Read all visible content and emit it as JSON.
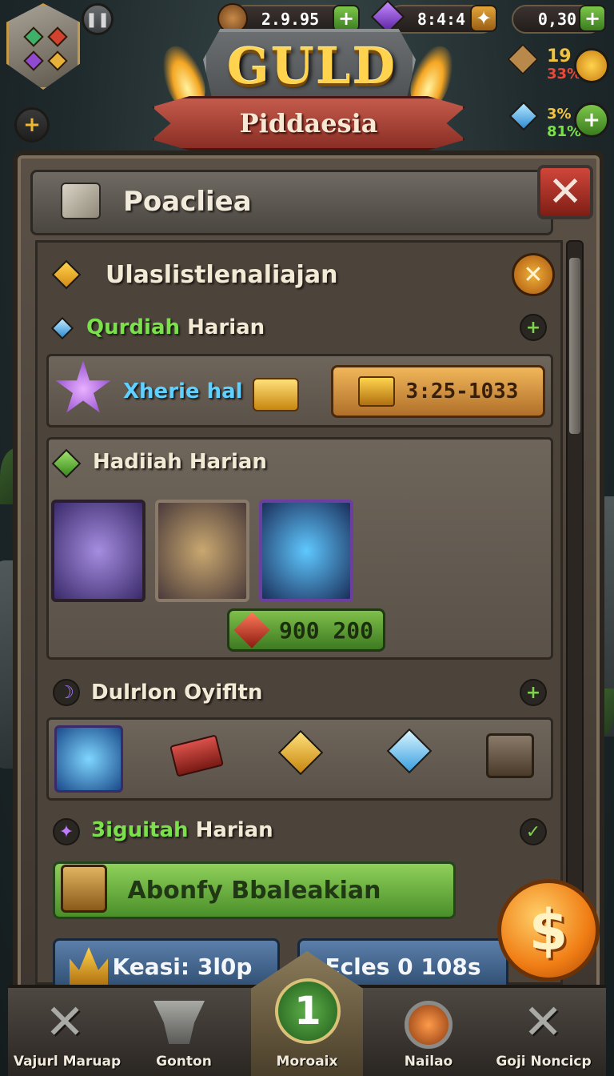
{
  "hud": {
    "resource_1": "2.9.95",
    "resource_2": "8:4:4",
    "resource_3": "0,30",
    "side_top_value": "19",
    "side_top_percent": "33%",
    "side_bottom_value": "3%",
    "side_bottom_percent": "81%"
  },
  "crest": {
    "title": "GULD",
    "subtitle": "Piddaesia"
  },
  "panel": {
    "title": "Poacliea"
  },
  "section_top": {
    "title": "Ulaslistlenaliajan"
  },
  "quest": {
    "title_highlight": "Qurdiah",
    "title_rest": " Harian",
    "item_label": "Xherie hal",
    "button_label": "3:25-1033"
  },
  "daily_reward": {
    "title": "Hadiiah Harian",
    "cost_label": "900 200"
  },
  "items_section": {
    "title": "Dulrlon Oyifltn"
  },
  "reward_section": {
    "title_highlight": "3iguitah",
    "title_rest": " Harian",
    "button_label": "Abonfy Bbaleakian"
  },
  "bottom_buttons": {
    "left": "Keasi: 3l0p",
    "right": "Ecles 0 108s",
    "coin_symbol": "$"
  },
  "nav": {
    "items": [
      {
        "label": "Vajurl Maruap"
      },
      {
        "label": "Gonton"
      },
      {
        "label": "Moroaix"
      },
      {
        "label": "Nailao"
      },
      {
        "label": "Goji Noncicp"
      }
    ],
    "center_symbol": "1"
  },
  "colors": {
    "accent_green": "#7be04c",
    "gold": "#ffd34d",
    "close_red": "#c43a2e"
  }
}
